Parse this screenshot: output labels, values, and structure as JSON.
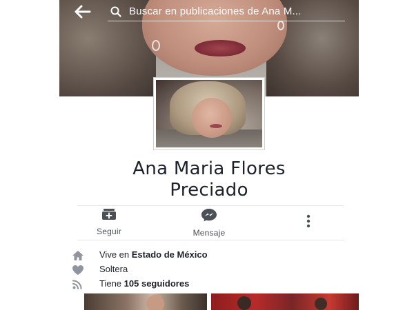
{
  "header": {
    "back_icon": "back-arrow-icon",
    "search_icon": "search-icon",
    "search_placeholder": "Buscar en publicaciones de Ana M..."
  },
  "profile": {
    "name_line1": "Ana Maria Flores",
    "name_line2": "Preciado"
  },
  "actions": {
    "follow_label": "Seguir",
    "follow_icon": "follow-add-icon",
    "message_label": "Mensaje",
    "message_icon": "messenger-icon",
    "more_icon": "more-vertical-icon"
  },
  "info": {
    "location_prefix": "Vive en ",
    "location_value": "Estado de México",
    "location_icon": "home-icon",
    "relationship": "Soltera",
    "relationship_icon": "heart-icon",
    "followers_prefix": "Tiene ",
    "followers_value": "105 seguidores",
    "followers_icon": "rss-icon"
  },
  "colors": {
    "text_primary": "#1d2129",
    "text_secondary": "#4b4f56",
    "icon_gray": "#90949c",
    "divider": "#e6e6e6"
  }
}
